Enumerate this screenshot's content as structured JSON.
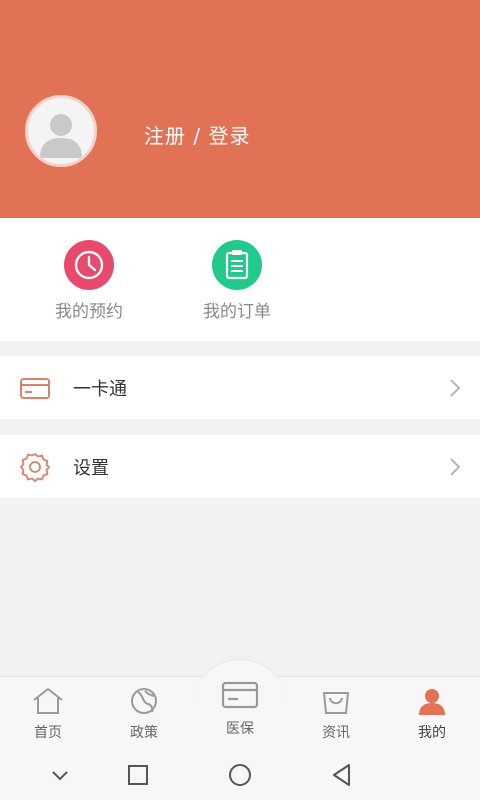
{
  "profile": {
    "login_label": "注册 / 登录",
    "avatar_icon": "default-user-avatar-icon"
  },
  "quick_actions": [
    {
      "label": "我的预约",
      "icon": "clock-icon",
      "color": "#e8496d"
    },
    {
      "label": "我的订单",
      "icon": "clipboard-icon",
      "color": "#21c98a"
    }
  ],
  "menu": [
    {
      "label": "一卡通",
      "icon": "card-icon"
    },
    {
      "label": "设置",
      "icon": "gear-icon"
    }
  ],
  "tabs": [
    {
      "label": "首页",
      "icon": "home-icon"
    },
    {
      "label": "政策",
      "icon": "policy-icon"
    },
    {
      "label": "医保",
      "icon": "card-icon"
    },
    {
      "label": "资讯",
      "icon": "news-bag-icon"
    },
    {
      "label": "我的",
      "icon": "person-icon",
      "active": true
    }
  ],
  "theme": {
    "header_bg": "#e27256",
    "accent": "#e27256",
    "page_bg": "#f2f1f4"
  }
}
